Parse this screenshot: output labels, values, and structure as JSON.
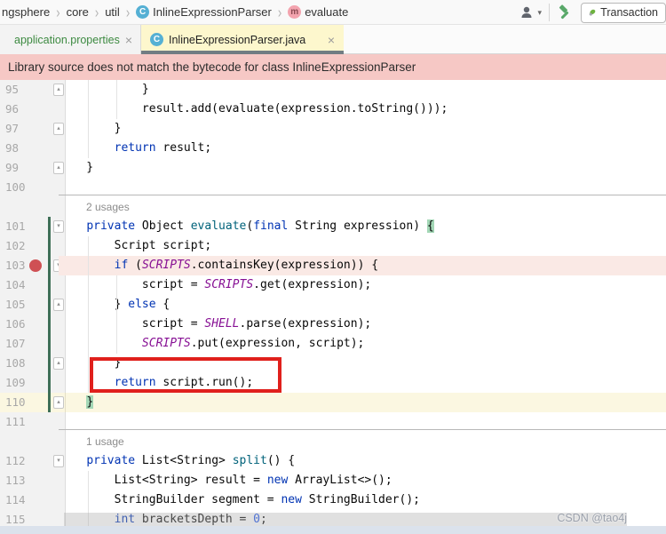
{
  "breadcrumb": {
    "separator": "›",
    "items": [
      {
        "label": "ngsphere"
      },
      {
        "label": "core"
      },
      {
        "label": "util"
      },
      {
        "label": "InlineExpressionParser",
        "icon": "class"
      },
      {
        "label": "evaluate",
        "icon": "method"
      }
    ]
  },
  "toolbar": {
    "run_config_label": "Transaction"
  },
  "tabs": {
    "items": [
      {
        "label": "application.properties",
        "close": "×"
      },
      {
        "label": "InlineExpressionParser.java",
        "close": "×"
      }
    ]
  },
  "banner": {
    "text": "Library source does not match the bytecode for class InlineExpressionParser"
  },
  "editor": {
    "lines": [
      {
        "num": "95",
        "fold": "up",
        "tokens": [
          [
            "t",
            "            }"
          ]
        ]
      },
      {
        "num": "96",
        "tokens": [
          [
            "t",
            "            result.add(evaluate(expression.toString()));"
          ]
        ]
      },
      {
        "num": "97",
        "fold": "up",
        "tokens": [
          [
            "t",
            "        }"
          ]
        ]
      },
      {
        "num": "98",
        "tokens": [
          [
            "t",
            "        "
          ],
          [
            "k",
            "return"
          ],
          [
            "t",
            " result;"
          ]
        ]
      },
      {
        "num": "99",
        "fold": "up",
        "tokens": [
          [
            "t",
            "    }"
          ]
        ]
      },
      {
        "num": "100",
        "tokens": []
      },
      {
        "inlay": "2 usages"
      },
      {
        "num": "101",
        "fold": "down",
        "tokens": [
          [
            "t",
            "    "
          ],
          [
            "k",
            "private"
          ],
          [
            "t",
            " Object "
          ],
          [
            "m",
            "evaluate"
          ],
          [
            "t",
            "("
          ],
          [
            "k",
            "final"
          ],
          [
            "t",
            " String expression) "
          ],
          [
            "b",
            "{"
          ]
        ]
      },
      {
        "num": "102",
        "tokens": [
          [
            "t",
            "        Script script;"
          ]
        ]
      },
      {
        "num": "103",
        "fold": "down",
        "breakpoint": true,
        "bg": "pink",
        "tokens": [
          [
            "t",
            "        "
          ],
          [
            "k",
            "if"
          ],
          [
            "t",
            " ("
          ],
          [
            "f",
            "SCRIPTS"
          ],
          [
            "t",
            ".containsKey(expression)) {"
          ]
        ]
      },
      {
        "num": "104",
        "tokens": [
          [
            "t",
            "            script = "
          ],
          [
            "f",
            "SCRIPTS"
          ],
          [
            "t",
            ".get(expression);"
          ]
        ]
      },
      {
        "num": "105",
        "fold": "up",
        "tokens": [
          [
            "t",
            "        } "
          ],
          [
            "k",
            "else"
          ],
          [
            "t",
            " {"
          ]
        ]
      },
      {
        "num": "106",
        "tokens": [
          [
            "t",
            "            script = "
          ],
          [
            "f",
            "SHELL"
          ],
          [
            "t",
            ".parse(expression);"
          ]
        ]
      },
      {
        "num": "107",
        "tokens": [
          [
            "t",
            "            "
          ],
          [
            "f",
            "SCRIPTS"
          ],
          [
            "t",
            ".put(expression, script);"
          ]
        ]
      },
      {
        "num": "108",
        "fold": "up",
        "tokens": [
          [
            "t",
            "        }"
          ]
        ]
      },
      {
        "num": "109",
        "tokens": [
          [
            "t",
            "        "
          ],
          [
            "k",
            "return"
          ],
          [
            "t",
            " script.run();"
          ]
        ]
      },
      {
        "num": "110",
        "fold": "up",
        "bg": "yellow",
        "tokens": [
          [
            "t",
            "    "
          ],
          [
            "b",
            "}"
          ]
        ]
      },
      {
        "num": "111",
        "tokens": []
      },
      {
        "inlay": "1 usage"
      },
      {
        "num": "112",
        "fold": "down",
        "tokens": [
          [
            "t",
            "    "
          ],
          [
            "k",
            "private"
          ],
          [
            "t",
            " List<String> "
          ],
          [
            "m",
            "split"
          ],
          [
            "t",
            "() {"
          ]
        ]
      },
      {
        "num": "113",
        "tokens": [
          [
            "t",
            "        List<String> result = "
          ],
          [
            "k",
            "new"
          ],
          [
            "t",
            " ArrayList<>();"
          ]
        ]
      },
      {
        "num": "114",
        "tokens": [
          [
            "t",
            "        StringBuilder segment = "
          ],
          [
            "k",
            "new"
          ],
          [
            "t",
            " StringBuilder();"
          ]
        ]
      },
      {
        "num": "115",
        "tokens": [
          [
            "t",
            "        "
          ],
          [
            "k",
            "int"
          ],
          [
            "t",
            " bracketsDepth = "
          ],
          [
            "n",
            "0"
          ],
          [
            "t",
            ";"
          ]
        ]
      }
    ]
  },
  "watermark": {
    "text": "CSDN @tao4j"
  },
  "colors": {
    "banner_bg": "#f6c8c5",
    "breakpoint_line_bg": "#fae9e5",
    "caret_line_bg": "#fbf7e1",
    "active_tab_bg": "#fdf7cd",
    "tab_underline": "#717d83",
    "keyword": "#0033b3",
    "static_field": "#871094",
    "method_decl": "#00627a",
    "number": "#1750eb",
    "brace_match_bg": "#a3d7b6",
    "vcs_added_bar": "#3e6f57",
    "breakpoint_dot": "#cf5054",
    "annotation_box": "#e0201c",
    "unselected_tab_text": "#3d8a41",
    "bottom_strip": "#dbe2ec"
  }
}
